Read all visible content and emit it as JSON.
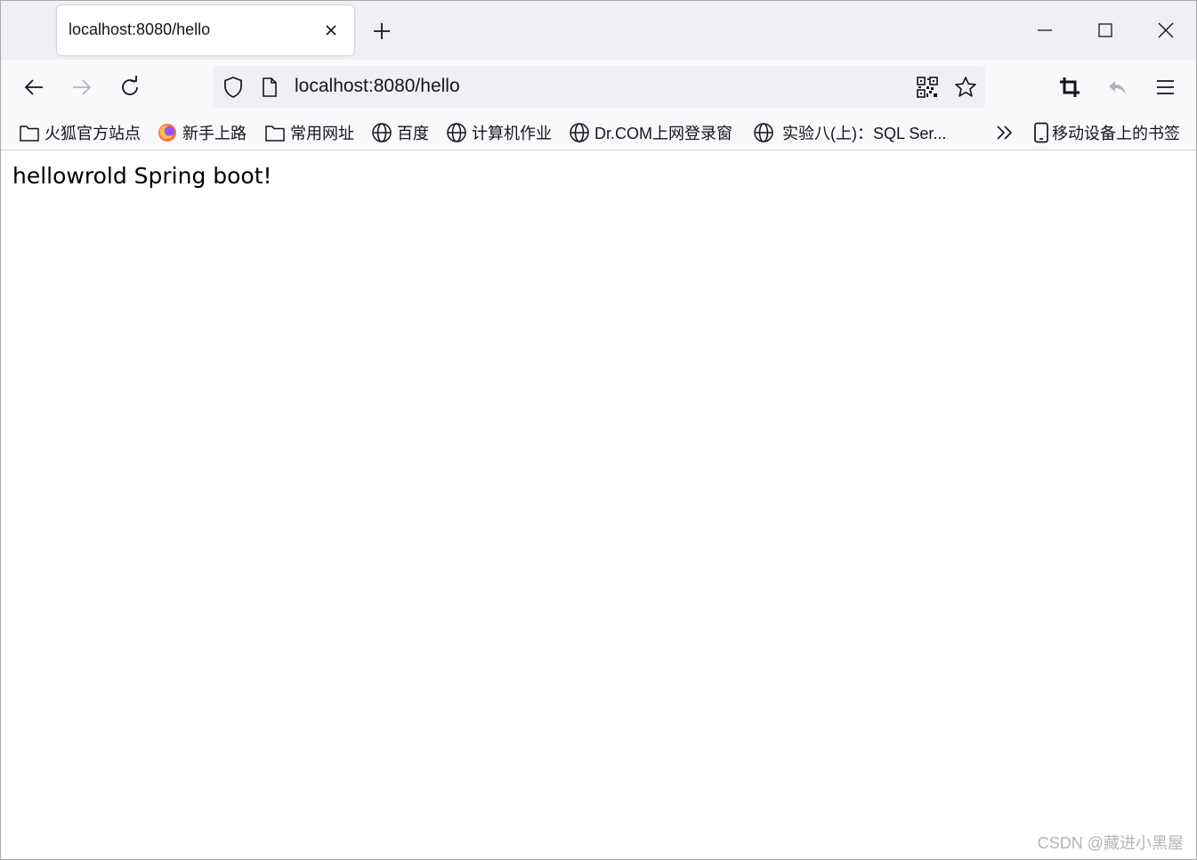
{
  "tab": {
    "title": "localhost:8080/hello"
  },
  "urlbar": {
    "url": "localhost:8080/hello"
  },
  "bookmarks": [
    {
      "label": "火狐官方站点",
      "icon": "folder-icon"
    },
    {
      "label": "新手上路",
      "icon": "firefox-icon"
    },
    {
      "label": "常用网址",
      "icon": "folder-icon"
    },
    {
      "label": "百度",
      "icon": "globe-icon"
    },
    {
      "label": "计算机作业",
      "icon": "globe-icon"
    },
    {
      "label": "Dr.COM上网登录窗",
      "icon": "globe-icon"
    },
    {
      "label": "实验八(上)：SQL Ser...",
      "icon": "globe-icon"
    }
  ],
  "mobile_bookmarks": {
    "label": "移动设备上的书签",
    "icon": "mobile-icon"
  },
  "page": {
    "text": "hellowrold Spring boot!"
  },
  "watermark": "CSDN @藏进小黑屋",
  "colors": {
    "tabstrip": "#f0f0f4",
    "toolbar": "#f9f9fb",
    "urlbar": "#f0f0f4",
    "firefox_orange": "#ff7139",
    "firefox_purple": "#9059ff"
  }
}
